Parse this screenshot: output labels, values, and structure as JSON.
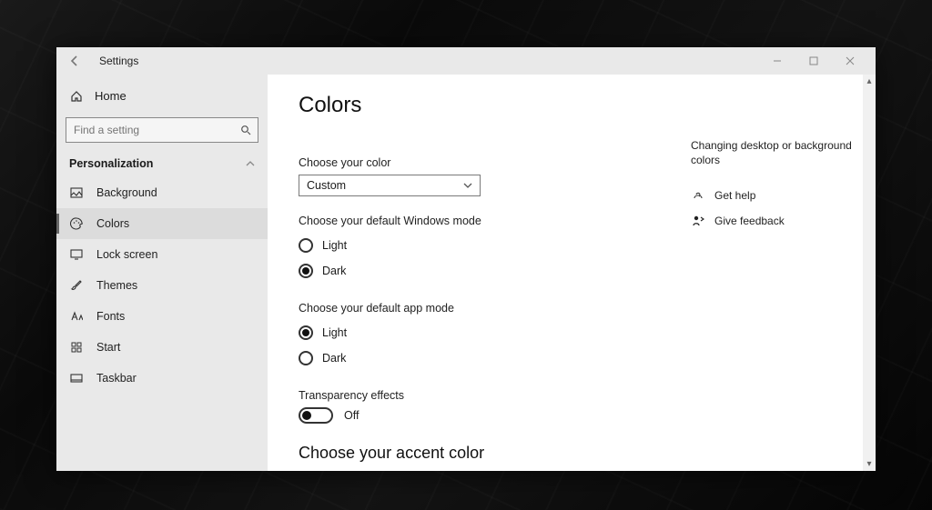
{
  "window": {
    "title": "Settings"
  },
  "home_label": "Home",
  "search": {
    "placeholder": "Find a setting"
  },
  "section": "Personalization",
  "nav": {
    "items": [
      {
        "label": "Background"
      },
      {
        "label": "Colors"
      },
      {
        "label": "Lock screen"
      },
      {
        "label": "Themes"
      },
      {
        "label": "Fonts"
      },
      {
        "label": "Start"
      },
      {
        "label": "Taskbar"
      }
    ],
    "selected_index": 1
  },
  "page": {
    "title": "Colors",
    "choose_color_label": "Choose your color",
    "color_mode_value": "Custom",
    "windows_mode_label": "Choose your default Windows mode",
    "windows_mode_options": {
      "light": "Light",
      "dark": "Dark"
    },
    "windows_mode_selected": "dark",
    "app_mode_label": "Choose your default app mode",
    "app_mode_options": {
      "light": "Light",
      "dark": "Dark"
    },
    "app_mode_selected": "light",
    "transparency_label": "Transparency effects",
    "transparency_state": "Off",
    "accent_heading": "Choose your accent color"
  },
  "side": {
    "tip": "Changing desktop or background colors",
    "help": "Get help",
    "feedback": "Give feedback"
  }
}
